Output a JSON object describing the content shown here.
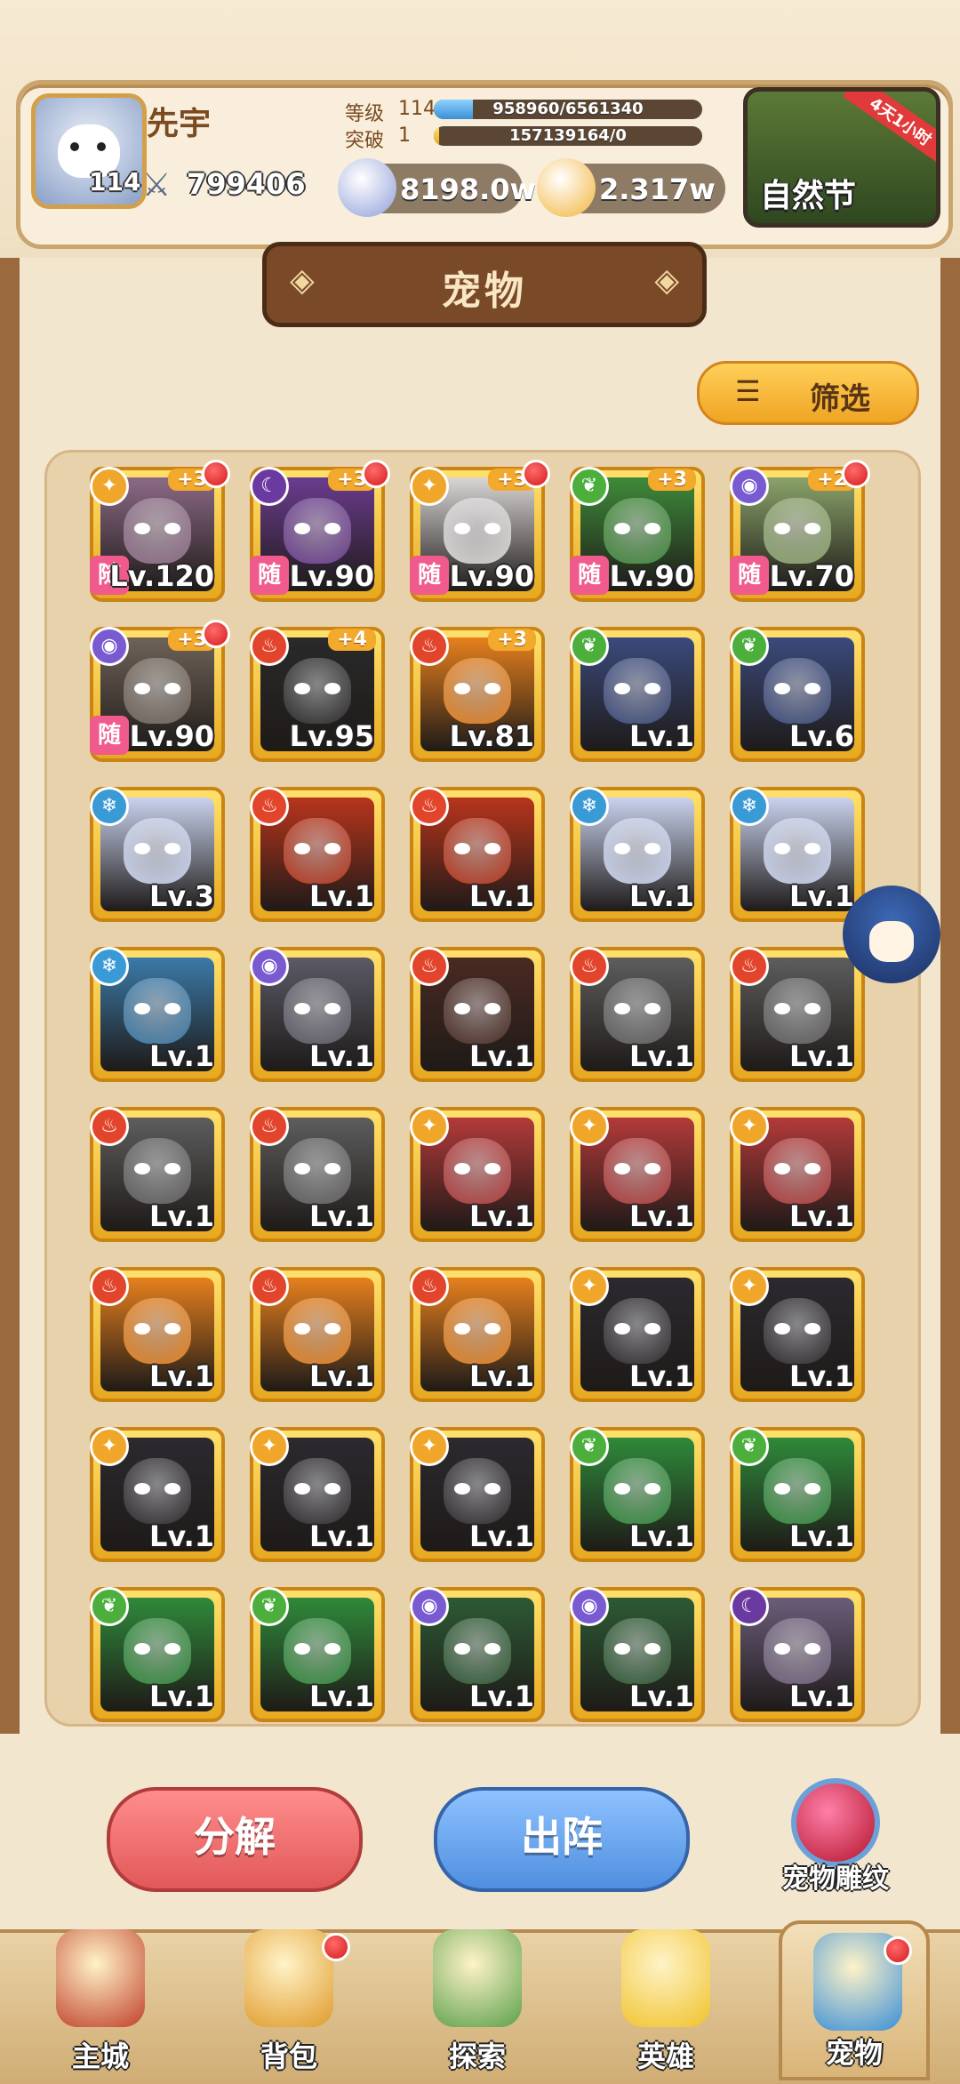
{
  "player": {
    "name": "先宇",
    "level": "114",
    "power": "799406",
    "stats": [
      {
        "label": "等级",
        "num": "114",
        "bar_text": "958960/6561340",
        "progress": 0.146
      },
      {
        "label": "突破",
        "num": "1",
        "bar_text": "157139164/0",
        "progress": 0.02
      }
    ],
    "currencies": [
      {
        "name": "silver-coin",
        "value": "8198.0w",
        "color": "#8f9fd8"
      },
      {
        "name": "gold-coin",
        "value": "2.317w",
        "color": "#f2b43a"
      }
    ]
  },
  "event": {
    "label": "自然节",
    "timer": "4天1小时"
  },
  "page": {
    "title": "宠物"
  },
  "filter": {
    "label": "筛选"
  },
  "pets": [
    {
      "element": "light",
      "plus": "+3",
      "dot": true,
      "random": true,
      "level": "Lv.120",
      "art": "#8c6a86"
    },
    {
      "element": "moon",
      "plus": "+3",
      "dot": true,
      "random": true,
      "level": "Lv.90",
      "art": "#6b3c8f"
    },
    {
      "element": "light",
      "plus": "+3",
      "dot": true,
      "random": true,
      "level": "Lv.90",
      "art": "#d9d6d6"
    },
    {
      "element": "nature",
      "plus": "+3",
      "dot": false,
      "random": true,
      "level": "Lv.90",
      "art": "#3f8a3a"
    },
    {
      "element": "eye",
      "plus": "+2",
      "dot": true,
      "random": true,
      "level": "Lv.70",
      "art": "#8aa36a"
    },
    {
      "element": "eye",
      "plus": "+3",
      "dot": true,
      "random": true,
      "level": "Lv.90",
      "art": "#6f6258"
    },
    {
      "element": "fire",
      "plus": "+4",
      "dot": false,
      "random": false,
      "level": "Lv.95",
      "art": "#2a2a2a"
    },
    {
      "element": "fire",
      "plus": "+3",
      "dot": false,
      "random": false,
      "level": "Lv.81",
      "art": "#e6801d"
    },
    {
      "element": "nature",
      "plus": "",
      "dot": false,
      "random": false,
      "level": "Lv.1",
      "art": "#3b4a7c"
    },
    {
      "element": "nature",
      "plus": "",
      "dot": false,
      "random": false,
      "level": "Lv.6",
      "art": "#3b4a7c"
    },
    {
      "element": "ice",
      "plus": "",
      "dot": false,
      "random": false,
      "level": "Lv.3",
      "art": "#c9d2ee"
    },
    {
      "element": "fire",
      "plus": "",
      "dot": false,
      "random": false,
      "level": "Lv.1",
      "art": "#b8351c"
    },
    {
      "element": "fire",
      "plus": "",
      "dot": false,
      "random": false,
      "level": "Lv.1",
      "art": "#b8351c"
    },
    {
      "element": "ice",
      "plus": "",
      "dot": false,
      "random": false,
      "level": "Lv.1",
      "art": "#c9d2ee"
    },
    {
      "element": "ice",
      "plus": "",
      "dot": false,
      "random": false,
      "level": "Lv.1",
      "art": "#c9d2ee"
    },
    {
      "element": "ice",
      "plus": "",
      "dot": false,
      "random": false,
      "level": "Lv.1",
      "art": "#3b7aa8"
    },
    {
      "element": "eye",
      "plus": "",
      "dot": false,
      "random": false,
      "level": "Lv.1",
      "art": "#5b5a66"
    },
    {
      "element": "fire",
      "plus": "",
      "dot": false,
      "random": false,
      "level": "Lv.1",
      "art": "#4a2a22"
    },
    {
      "element": "fire",
      "plus": "",
      "dot": false,
      "random": false,
      "level": "Lv.1",
      "art": "#5d5d5d"
    },
    {
      "element": "fire",
      "plus": "",
      "dot": false,
      "random": false,
      "level": "Lv.1",
      "art": "#5d5d5d"
    },
    {
      "element": "fire",
      "plus": "",
      "dot": false,
      "random": false,
      "level": "Lv.1",
      "art": "#5d5d5d"
    },
    {
      "element": "fire",
      "plus": "",
      "dot": false,
      "random": false,
      "level": "Lv.1",
      "art": "#5d5d5d"
    },
    {
      "element": "light",
      "plus": "",
      "dot": false,
      "random": false,
      "level": "Lv.1",
      "art": "#b33a3a"
    },
    {
      "element": "light",
      "plus": "",
      "dot": false,
      "random": false,
      "level": "Lv.1",
      "art": "#b33a3a"
    },
    {
      "element": "light",
      "plus": "",
      "dot": false,
      "random": false,
      "level": "Lv.1",
      "art": "#b33a3a"
    },
    {
      "element": "fire",
      "plus": "",
      "dot": false,
      "random": false,
      "level": "Lv.1",
      "art": "#e6801d"
    },
    {
      "element": "fire",
      "plus": "",
      "dot": false,
      "random": false,
      "level": "Lv.1",
      "art": "#e6801d"
    },
    {
      "element": "fire",
      "plus": "",
      "dot": false,
      "random": false,
      "level": "Lv.1",
      "art": "#e6801d"
    },
    {
      "element": "light",
      "plus": "",
      "dot": false,
      "random": false,
      "level": "Lv.1",
      "art": "#2c2a2f"
    },
    {
      "element": "light",
      "plus": "",
      "dot": false,
      "random": false,
      "level": "Lv.1",
      "art": "#2c2a2f"
    },
    {
      "element": "light",
      "plus": "",
      "dot": false,
      "random": false,
      "level": "Lv.1",
      "art": "#2c2a2f"
    },
    {
      "element": "light",
      "plus": "",
      "dot": false,
      "random": false,
      "level": "Lv.1",
      "art": "#2c2a2f"
    },
    {
      "element": "light",
      "plus": "",
      "dot": false,
      "random": false,
      "level": "Lv.1",
      "art": "#2c2a2f"
    },
    {
      "element": "nature",
      "plus": "",
      "dot": false,
      "random": false,
      "level": "Lv.1",
      "art": "#2f8a3a"
    },
    {
      "element": "nature",
      "plus": "",
      "dot": false,
      "random": false,
      "level": "Lv.1",
      "art": "#2f8a3a"
    },
    {
      "element": "nature",
      "plus": "",
      "dot": false,
      "random": false,
      "level": "Lv.1",
      "art": "#2f8a3a"
    },
    {
      "element": "nature",
      "plus": "",
      "dot": false,
      "random": false,
      "level": "Lv.1",
      "art": "#2f8a3a"
    },
    {
      "element": "eye",
      "plus": "",
      "dot": false,
      "random": false,
      "level": "Lv.1",
      "art": "#2d5a34"
    },
    {
      "element": "eye",
      "plus": "",
      "dot": false,
      "random": false,
      "level": "Lv.1",
      "art": "#2d5a34"
    },
    {
      "element": "moon",
      "plus": "",
      "dot": false,
      "random": false,
      "level": "Lv.1",
      "art": "#6b5d7a"
    }
  ],
  "actions": {
    "decompose": "分解",
    "deploy": "出阵",
    "engrave": "宠物雕纹"
  },
  "nav": [
    {
      "key": "main-city",
      "label": "主城",
      "color": "#c0402a",
      "dot": false,
      "active": false
    },
    {
      "key": "backpack",
      "label": "背包",
      "color": "#e09a2a",
      "dot": true,
      "active": false
    },
    {
      "key": "explore",
      "label": "探索",
      "color": "#5aa04a",
      "dot": false,
      "active": false
    },
    {
      "key": "hero",
      "label": "英雄",
      "color": "#f0c22a",
      "dot": false,
      "active": false
    },
    {
      "key": "pet",
      "label": "宠物",
      "color": "#3a8fd6",
      "dot": true,
      "active": true
    }
  ],
  "element_colors": {
    "fire": "#e2452b",
    "ice": "#3a9ad6",
    "light": "#f0a62a",
    "nature": "#4caf3c",
    "moon": "#6b3aa0",
    "eye": "#7a5ad0"
  },
  "element_glyphs": {
    "fire": "♨",
    "ice": "❄",
    "light": "✦",
    "nature": "❦",
    "moon": "☾",
    "eye": "◉"
  }
}
